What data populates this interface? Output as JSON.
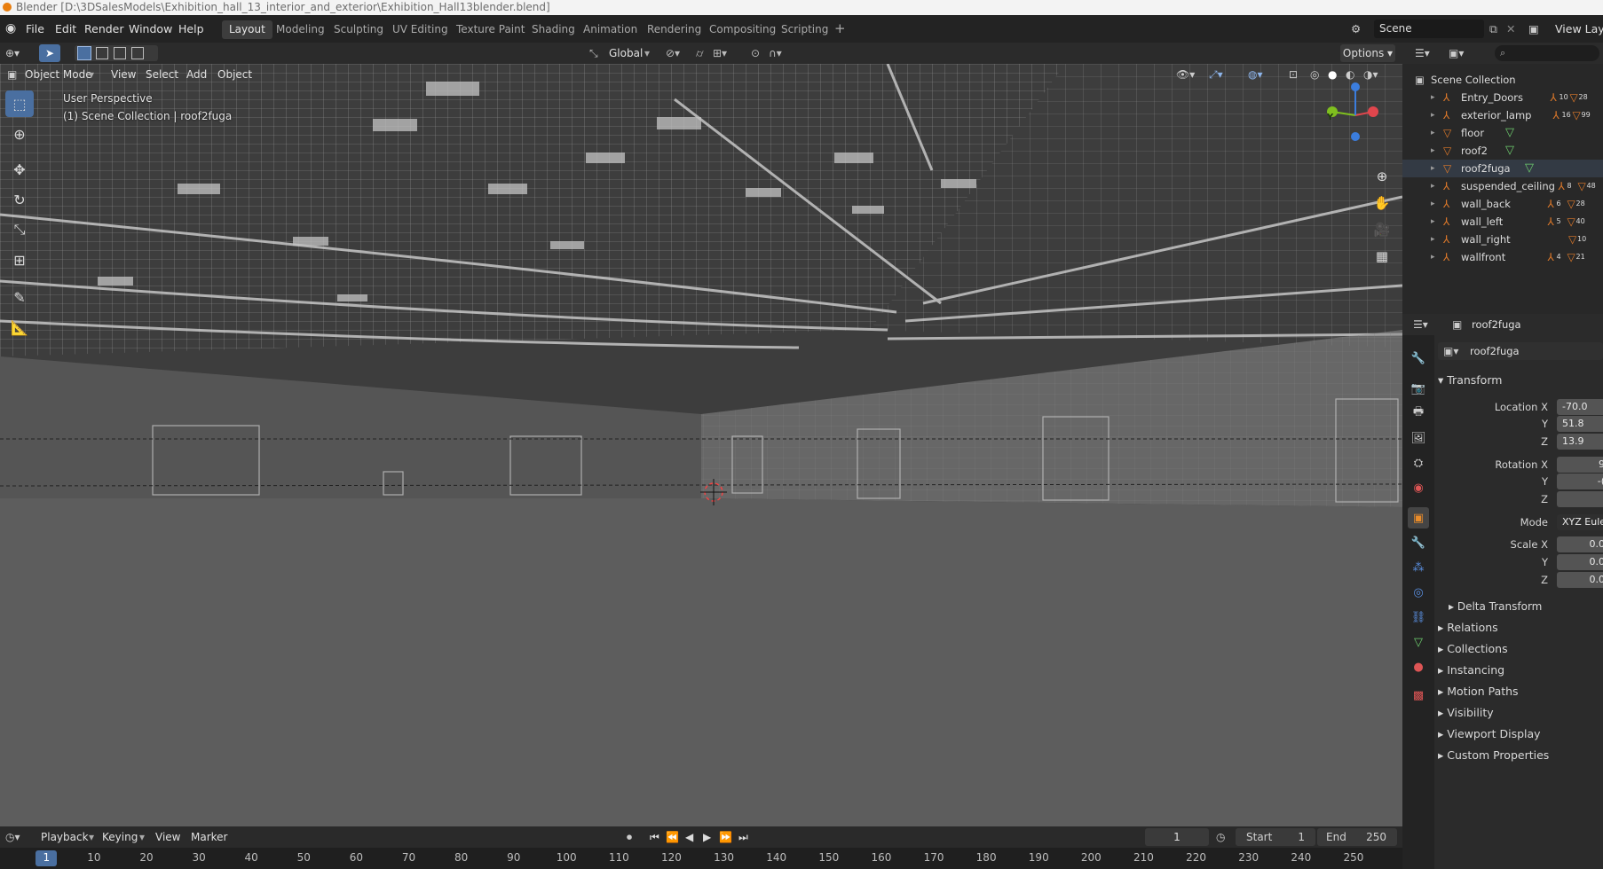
{
  "title_bar": {
    "text": "Blender [D:\\3DSalesModels\\Exhibition_hall_13_interior_and_exterior\\Exhibition_Hall13blender.blend]"
  },
  "menu": {
    "file": "File",
    "edit": "Edit",
    "render": "Render",
    "window": "Window",
    "help": "Help"
  },
  "workspaces": [
    "Layout",
    "Modeling",
    "Sculpting",
    "UV Editing",
    "Texture Paint",
    "Shading",
    "Animation",
    "Rendering",
    "Compositing",
    "Scripting"
  ],
  "active_workspace": "Layout",
  "scene": {
    "label": "Scene",
    "view_layer": "View Layer"
  },
  "viewport_header": {
    "mode": "Object Mode",
    "view": "View",
    "select": "Select",
    "add": "Add",
    "object": "Object",
    "orientation": "Global",
    "options": "Options"
  },
  "viewport_overlay": {
    "perspective": "User Perspective",
    "collection_info": "(1) Scene Collection | roof2fuga"
  },
  "gizmo": {
    "y_label": "Y"
  },
  "outliner": {
    "root": "Scene Collection",
    "items": [
      {
        "name": "Entry_Doors",
        "c1": "10",
        "c2": "28"
      },
      {
        "name": "exterior_lamp",
        "c1": "16",
        "c2": "99"
      },
      {
        "name": "floor",
        "c1": "",
        "c2": ""
      },
      {
        "name": "roof2",
        "c1": "",
        "c2": ""
      },
      {
        "name": "roof2fuga",
        "c1": "",
        "c2": ""
      },
      {
        "name": "suspended_ceiling",
        "c1": "8",
        "c2": "48"
      },
      {
        "name": "wall_back",
        "c1": "6",
        "c2": "28"
      },
      {
        "name": "wall_left",
        "c1": "5",
        "c2": "40"
      },
      {
        "name": "wall_right",
        "c1": "",
        "c2": "10"
      },
      {
        "name": "wallfront",
        "c1": "4",
        "c2": "21"
      }
    ]
  },
  "properties": {
    "header_object": "roof2fuga",
    "object_name": "roof2fuga",
    "transform_title": "Transform",
    "location": {
      "label_x": "Location X",
      "label_y": "Y",
      "label_z": "Z",
      "x": "-70.0",
      "y": "51.8",
      "z": "13.9"
    },
    "rotation": {
      "label_x": "Rotation X",
      "label_y": "Y",
      "label_z": "Z",
      "x": "9",
      "y": "-(",
      "z": ""
    },
    "mode": {
      "label": "Mode",
      "value": "XYZ Euler"
    },
    "scale": {
      "label_x": "Scale X",
      "label_y": "Y",
      "label_z": "Z",
      "x": "0.0",
      "y": "0.0",
      "z": "0.0"
    },
    "delta_transform": "Delta Transform",
    "sections": [
      "Relations",
      "Collections",
      "Instancing",
      "Motion Paths",
      "Visibility",
      "Viewport Display",
      "Custom Properties"
    ]
  },
  "timeline": {
    "playback": "Playback",
    "keying": "Keying",
    "view": "View",
    "marker": "Marker",
    "current_frame": "1",
    "start_label": "Start",
    "start": "1",
    "end_label": "End",
    "end": "250",
    "ruler": [
      "1",
      "10",
      "20",
      "30",
      "40",
      "50",
      "60",
      "70",
      "80",
      "90",
      "100",
      "110",
      "120",
      "130",
      "140",
      "150",
      "160",
      "170",
      "180",
      "190",
      "200",
      "210",
      "220",
      "230",
      "240",
      "250"
    ]
  },
  "colors": {
    "accent": "#4a6fa0",
    "object_orange": "#e07a2a",
    "mesh_green": "#6fcf6f",
    "viewport_floor": "#5d5d5d",
    "ceiling": "#4a4a4a"
  }
}
